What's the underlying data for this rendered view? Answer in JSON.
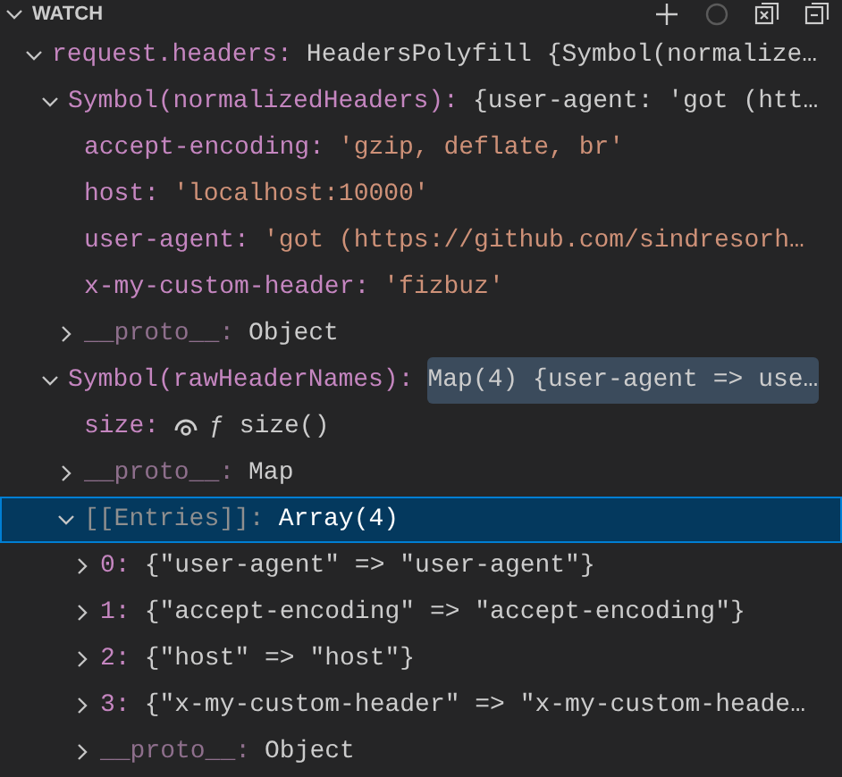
{
  "panel": {
    "title": "WATCH",
    "expanded": true
  },
  "tree": [
    {
      "name": "request.headers:",
      "value": "HeadersPolyfill {Symbol(normalize…",
      "kind": "object",
      "expanded": true,
      "selected": false,
      "hovered": false,
      "children": [
        {
          "name": "Symbol(normalizedHeaders):",
          "value": "{user-agent: 'got (htt…",
          "kind": "object",
          "expanded": true,
          "selected": false,
          "hovered": false,
          "children": [
            {
              "name": "accept-encoding:",
              "value": "'gzip, deflate, br'",
              "kind": "string",
              "selected": false,
              "hovered": false
            },
            {
              "name": "host:",
              "value": "'localhost:10000'",
              "kind": "string",
              "selected": false,
              "hovered": false
            },
            {
              "name": "user-agent:",
              "value": "'got (https://github.com/sindresorh…",
              "kind": "string",
              "selected": false,
              "hovered": false
            },
            {
              "name": "x-my-custom-header:",
              "value": "'fizbuz'",
              "kind": "string",
              "selected": false,
              "hovered": false
            },
            {
              "name": "__proto__:",
              "value": "Object",
              "kind": "proto",
              "expanded": false,
              "selected": false,
              "hovered": false
            }
          ]
        },
        {
          "name": "Symbol(rawHeaderNames):",
          "value": "Map(4) {user-agent => use…",
          "kind": "object",
          "expanded": true,
          "selected": false,
          "hovered": true,
          "children": [
            {
              "name": "size:",
              "value": "ƒ size()",
              "kind": "getter",
              "selected": false,
              "hovered": false
            },
            {
              "name": "__proto__:",
              "value": "Map",
              "kind": "proto",
              "expanded": false,
              "selected": false,
              "hovered": false
            },
            {
              "name": "[[Entries]]:",
              "value": "Array(4)",
              "kind": "internal",
              "expanded": true,
              "selected": true,
              "hovered": false,
              "children": [
                {
                  "name": "0:",
                  "value": "{\"user-agent\" => \"user-agent\"}",
                  "kind": "object",
                  "expanded": false,
                  "selected": false,
                  "hovered": false
                },
                {
                  "name": "1:",
                  "value": "{\"accept-encoding\" => \"accept-encoding\"}",
                  "kind": "object",
                  "expanded": false,
                  "selected": false,
                  "hovered": false
                },
                {
                  "name": "2:",
                  "value": "{\"host\" => \"host\"}",
                  "kind": "object",
                  "expanded": false,
                  "selected": false,
                  "hovered": false
                },
                {
                  "name": "3:",
                  "value": "{\"x-my-custom-header\" => \"x-my-custom-heade…",
                  "kind": "object",
                  "expanded": false,
                  "selected": false,
                  "hovered": false
                },
                {
                  "name": "__proto__:",
                  "value": "Object",
                  "kind": "proto",
                  "expanded": false,
                  "selected": false,
                  "hovered": false
                }
              ]
            }
          ]
        }
      ]
    }
  ]
}
